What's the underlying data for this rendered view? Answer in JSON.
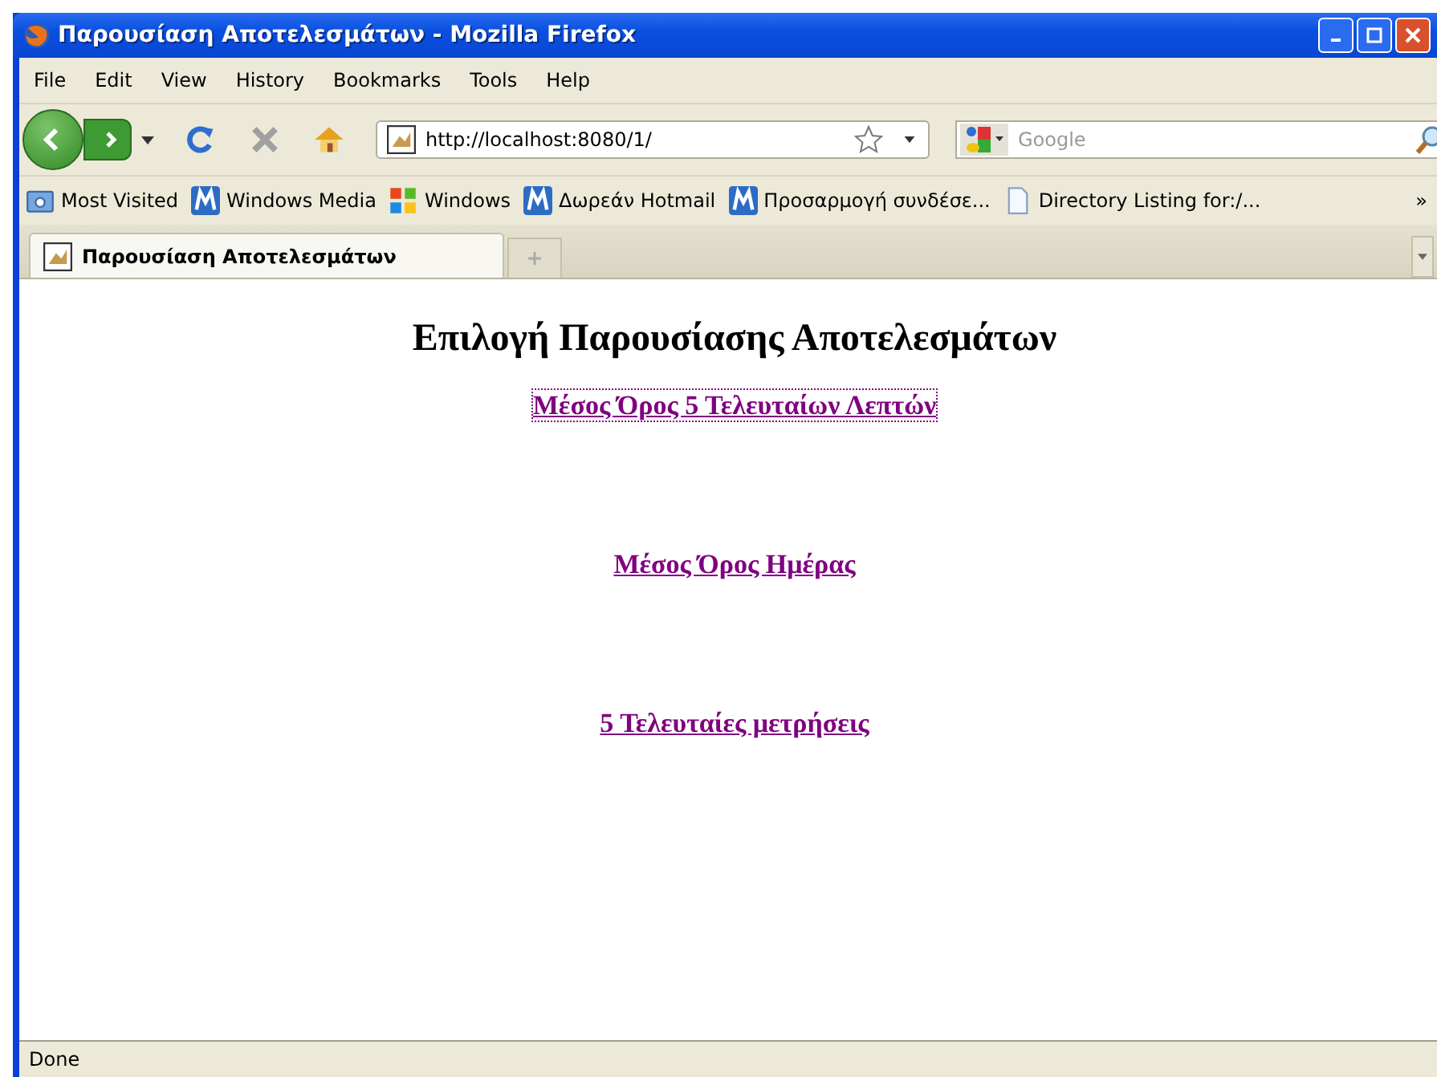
{
  "window": {
    "title": "Παρουσίαση Αποτελεσμάτων - Mozilla Firefox"
  },
  "menu": [
    "File",
    "Edit",
    "View",
    "History",
    "Bookmarks",
    "Tools",
    "Help"
  ],
  "address": {
    "value": "http://localhost:8080/1/"
  },
  "search": {
    "placeholder": "Google"
  },
  "bookmarks": [
    {
      "label": "Most Visited",
      "kind": "folder"
    },
    {
      "label": "Windows Media",
      "kind": "m"
    },
    {
      "label": "Windows",
      "kind": "windows"
    },
    {
      "label": "Δωρεάν Hotmail",
      "kind": "m"
    },
    {
      "label": "Προσαρμογή συνδέσε...",
      "kind": "m"
    },
    {
      "label": "Directory Listing for:/...",
      "kind": "page"
    }
  ],
  "bookmarks_more": "»",
  "tabs": [
    {
      "label": "Παρουσίαση Αποτελεσμάτων",
      "selected": true
    }
  ],
  "page": {
    "heading": "Επιλογή Παρουσίασης Αποτελεσμάτων",
    "links": [
      {
        "label": "Μέσος Όρος 5 Τελευταίων Λεπτών",
        "focused": true
      },
      {
        "label": "Μέσος Όρος Ημέρας",
        "focused": false
      },
      {
        "label": "5 Τελευταίες μετρήσεις",
        "focused": false
      }
    ]
  },
  "status_bar": "Done"
}
